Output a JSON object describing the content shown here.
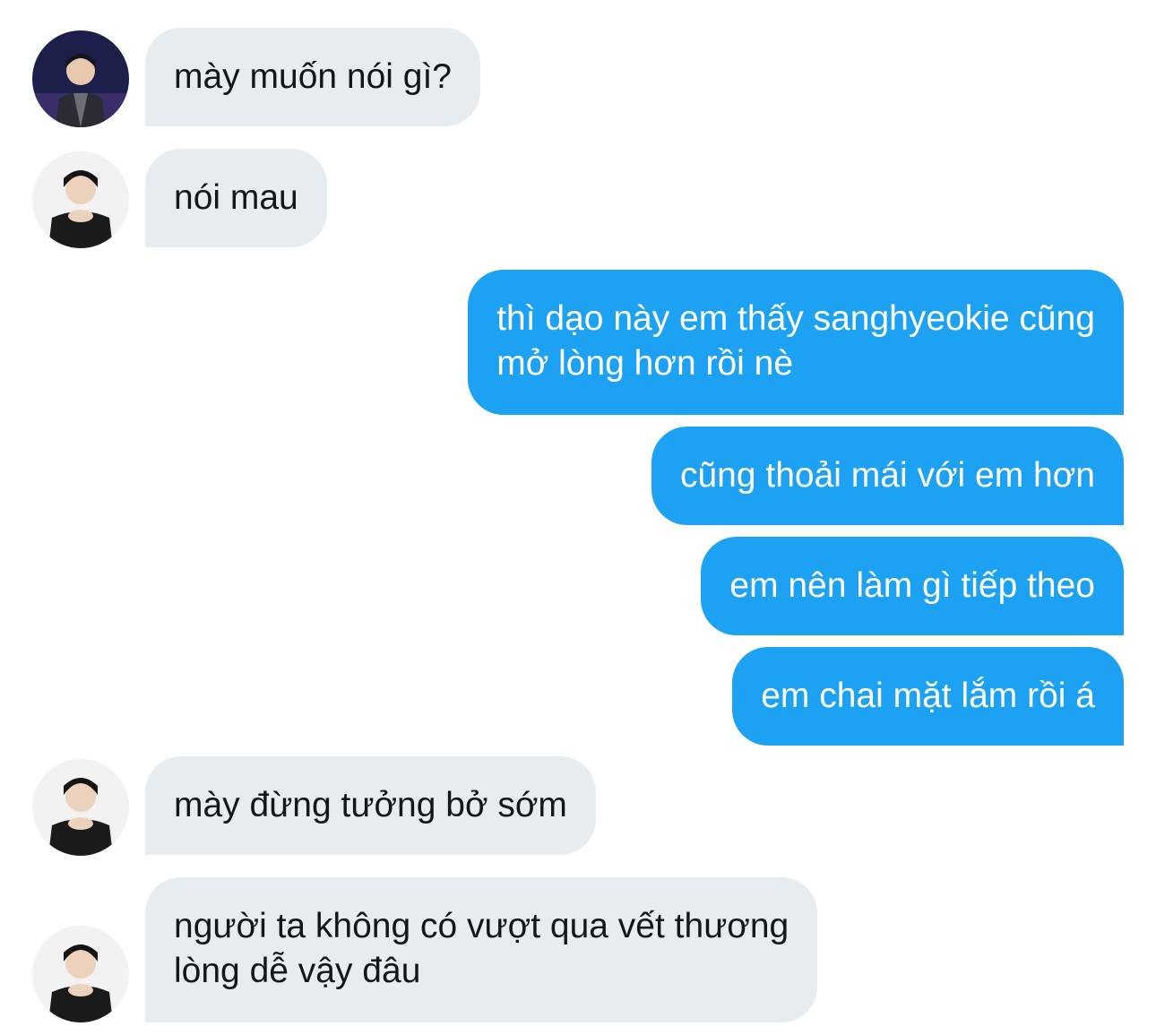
{
  "colors": {
    "incoming_bubble": "#e6ecf0",
    "outgoing_bubble": "#1da1f2",
    "incoming_text": "#14171a",
    "outgoing_text": "#ffffff"
  },
  "messages": [
    {
      "sender": "other",
      "avatar": "user-avatar-stage",
      "lines": [
        "mày muốn nói gì?"
      ]
    },
    {
      "sender": "other",
      "avatar": "user-avatar",
      "lines": [
        "nói mau"
      ]
    },
    {
      "sender": "me",
      "lines": [
        "thì dạo này em thấy sanghyeokie cũng",
        "mở lòng hơn rồi nè"
      ]
    },
    {
      "sender": "me",
      "lines": [
        "cũng thoải mái với em hơn"
      ]
    },
    {
      "sender": "me",
      "lines": [
        "em nên làm gì tiếp theo"
      ]
    },
    {
      "sender": "me",
      "lines": [
        "em chai mặt lắm rồi á"
      ]
    },
    {
      "sender": "other",
      "avatar": "user-avatar",
      "lines": [
        "mày đừng tưởng bở sớm"
      ]
    },
    {
      "sender": "other",
      "avatar": "user-avatar",
      "lines": [
        "người ta không có vượt qua vết thương",
        "lòng dễ vậy đâu"
      ]
    }
  ]
}
